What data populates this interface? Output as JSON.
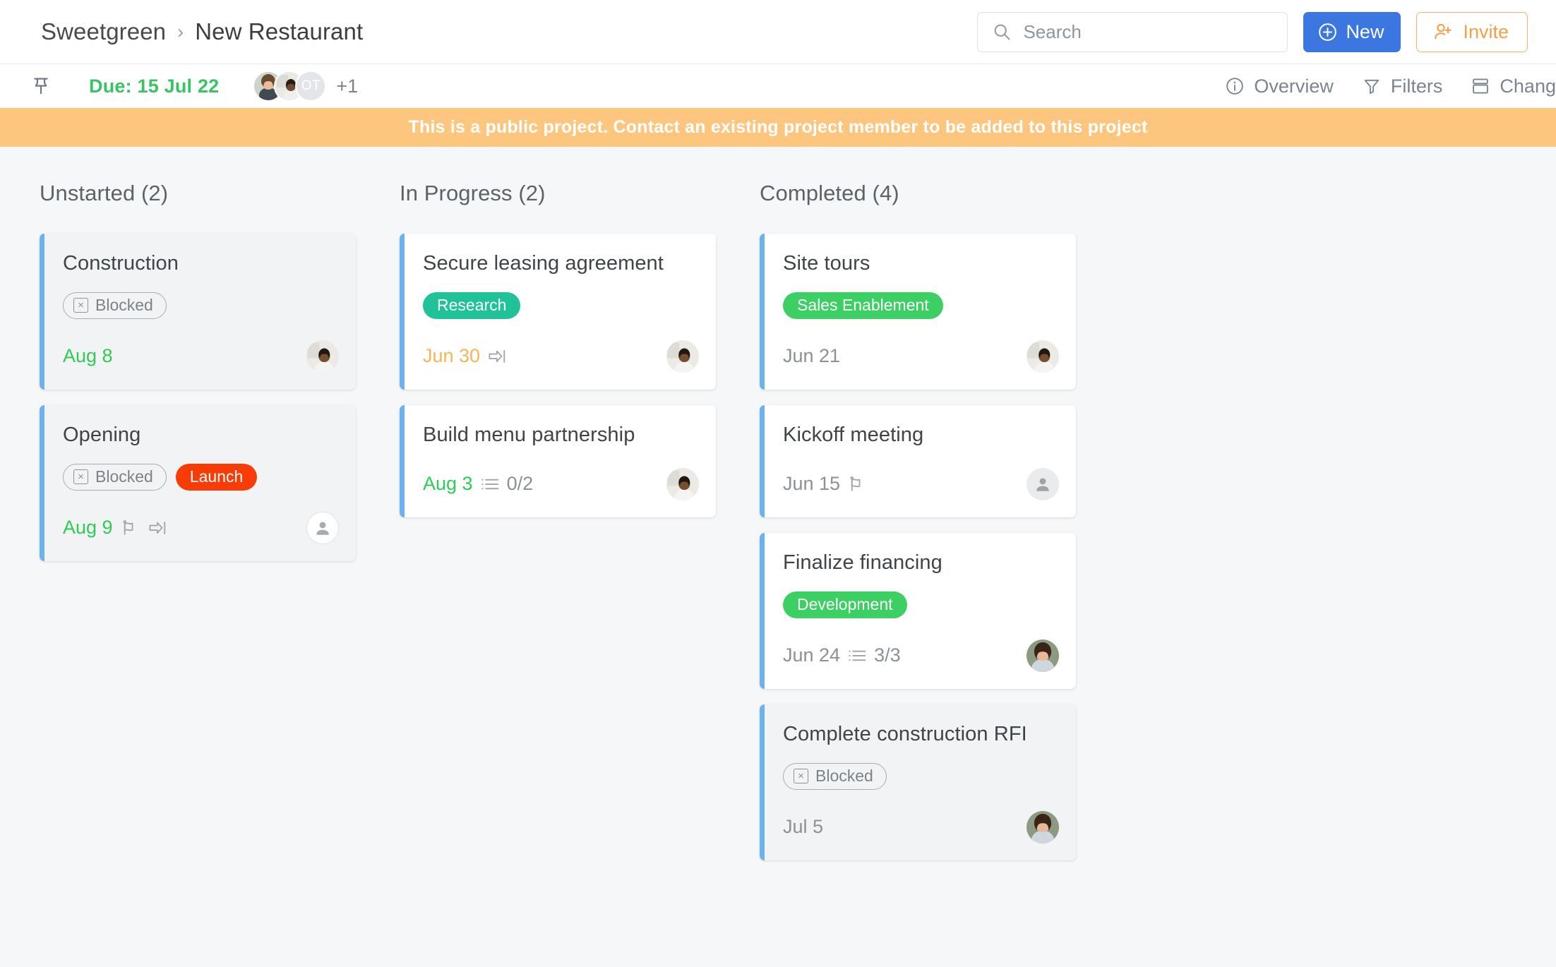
{
  "header": {
    "breadcrumb": {
      "root": "Sweetgreen",
      "separator": "›",
      "current": "New Restaurant"
    },
    "search": {
      "placeholder": "Search",
      "value": ""
    },
    "new_button": "New",
    "invite_button": "Invite"
  },
  "toolbar": {
    "due_label": "Due: 15 Jul 22",
    "members": [
      {
        "type": "photo",
        "tone": "woman"
      },
      {
        "type": "photo",
        "tone": "man"
      },
      {
        "type": "initials",
        "initials": "OT"
      }
    ],
    "overflow_count": "+1",
    "actions": [
      {
        "label": "Overview",
        "icon": "info-icon"
      },
      {
        "label": "Filters",
        "icon": "funnel-icon"
      },
      {
        "label": "Chang",
        "icon": "change-view-icon"
      }
    ]
  },
  "banner": {
    "text": "This is a public project. Contact an existing project member to be added to this project",
    "background": "#fdc67e"
  },
  "colors": {
    "accent_blue": "#3b76e1",
    "card_bar": "#6cb2ef",
    "invite_orange": "#f5a04a",
    "green": "#2ecc55",
    "amber": "#f5b458",
    "gray_text": "#8b9196"
  },
  "board": {
    "columns": [
      {
        "title": "Unstarted (2)",
        "cards": [
          {
            "title": "Construction",
            "dim": true,
            "tags": [
              {
                "label": "Blocked",
                "style": "blocked"
              }
            ],
            "date": "Aug 8",
            "date_style": "green",
            "icons": [],
            "checklist": "",
            "avatar": "photo-man"
          },
          {
            "title": "Opening",
            "dim": true,
            "tags": [
              {
                "label": "Blocked",
                "style": "blocked"
              },
              {
                "label": "Launch",
                "style": "solid",
                "color": "#f93b06"
              }
            ],
            "date": "Aug 9",
            "date_style": "green",
            "icons": [
              "flag-icon",
              "move-to-end-icon"
            ],
            "checklist": "",
            "avatar": "placeholder-outline"
          }
        ]
      },
      {
        "title": "In Progress (2)",
        "cards": [
          {
            "title": "Secure leasing agreement",
            "dim": false,
            "tags": [
              {
                "label": "Research",
                "style": "solid",
                "color": "#20c29a"
              }
            ],
            "date": "Jun 30",
            "date_style": "amber",
            "icons": [
              "move-to-end-icon"
            ],
            "checklist": "",
            "avatar": "photo-man"
          },
          {
            "title": "Build menu partnership",
            "dim": false,
            "tags": [],
            "date": "Aug 3",
            "date_style": "green",
            "icons": [
              "checklist-icon"
            ],
            "checklist": "0/2",
            "avatar": "photo-man"
          }
        ]
      },
      {
        "title": "Completed (4)",
        "cards": [
          {
            "title": "Site tours",
            "dim": false,
            "tags": [
              {
                "label": "Sales Enablement",
                "style": "solid",
                "color": "#3ccf63"
              }
            ],
            "date": "Jun 21",
            "date_style": "gray",
            "icons": [],
            "checklist": "",
            "avatar": "photo-man"
          },
          {
            "title": "Kickoff meeting",
            "dim": false,
            "tags": [],
            "date": "Jun 15",
            "date_style": "gray",
            "icons": [
              "flag-icon"
            ],
            "checklist": "",
            "avatar": "placeholder-fill"
          },
          {
            "title": "Finalize financing",
            "dim": false,
            "tags": [
              {
                "label": "Development",
                "style": "solid",
                "color": "#3ccf63"
              }
            ],
            "date": "Jun 24",
            "date_style": "gray",
            "icons": [
              "checklist-icon"
            ],
            "checklist": "3/3",
            "avatar": "photo-woman"
          },
          {
            "title": "Complete construction RFI",
            "dim": true,
            "tags": [
              {
                "label": "Blocked",
                "style": "blocked"
              }
            ],
            "date": "Jul 5",
            "date_style": "gray",
            "icons": [],
            "checklist": "",
            "avatar": "photo-woman"
          }
        ]
      }
    ]
  }
}
